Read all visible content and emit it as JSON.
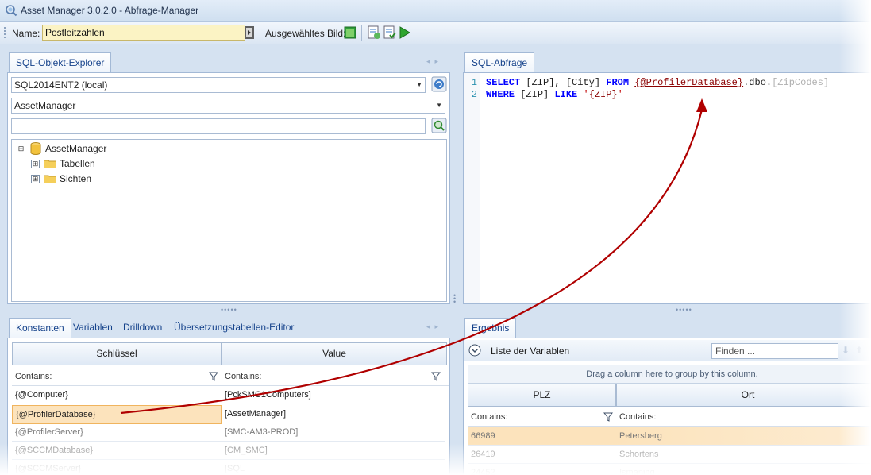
{
  "window": {
    "title": "Asset Manager 3.0.2.0 - Abfrage-Manager"
  },
  "toolbar": {
    "name_label": "Name:",
    "name_value": "Postleitzahlen",
    "image_label": "Ausgewähltes Bild:"
  },
  "explorer": {
    "tab": "SQL-Objekt-Explorer",
    "server": "SQL2014ENT2 (local)",
    "database": "AssetManager",
    "search_value": "",
    "tree": [
      {
        "label": "AssetManager",
        "expander": "⊟",
        "icon": "database-icon"
      },
      {
        "label": "Tabellen",
        "expander": "⊞",
        "icon": "folder-icon"
      },
      {
        "label": "Sichten",
        "expander": "⊞",
        "icon": "folder-icon"
      }
    ]
  },
  "bottom_left": {
    "tabs": [
      "Konstanten",
      "Variablen",
      "Drilldown",
      "Übersetzungstabellen-Editor"
    ],
    "columns": [
      "Schlüssel",
      "Value"
    ],
    "filter_label": "Contains:",
    "rows": [
      {
        "key": "{@Computer}",
        "value": "[PckSMC1Computers]"
      },
      {
        "key": "{@ProfilerDatabase}",
        "value": "[AssetManager]"
      },
      {
        "key": "{@ProfilerServer}",
        "value": "[SMC-AM3-PROD]"
      },
      {
        "key": "{@SCCMDatabase}",
        "value": "[CM_SMC]"
      },
      {
        "key": "{@SCCMServer}",
        "value": "[SQL"
      }
    ]
  },
  "sql": {
    "tab": "SQL-Abfrage",
    "line_numbers": [
      "1",
      "2"
    ],
    "line1": {
      "kw1": "SELECT",
      "cols": " [ZIP], [City] ",
      "kw2": "FROM",
      "sp": " ",
      "param": "{@ProfilerDatabase}",
      "rest": ".dbo.",
      "dim": "[ZipCodes]"
    },
    "line2": {
      "kw1": "WHERE",
      "col": " [ZIP] ",
      "kw2": "LIKE",
      "sp": " ",
      "q1": "'",
      "param": "{ZIP}",
      "q2": "'"
    }
  },
  "results": {
    "tab": "Ergebnis",
    "variables_label": "Liste der Variablen",
    "search_placeholder": "Finden ...",
    "group_hint": "Drag a column here to group by this column.",
    "columns": [
      "PLZ",
      "Ort"
    ],
    "filter_label": "Contains:",
    "rows": [
      {
        "plz": "66989",
        "ort": "Petersberg"
      },
      {
        "plz": "26419",
        "ort": "Schortens"
      },
      {
        "plz": "24452",
        "ort": "Ismaning"
      }
    ]
  },
  "colors": {
    "selected_row": "#fce3bc",
    "arrow": "#b00000",
    "accent": "#15428b"
  }
}
